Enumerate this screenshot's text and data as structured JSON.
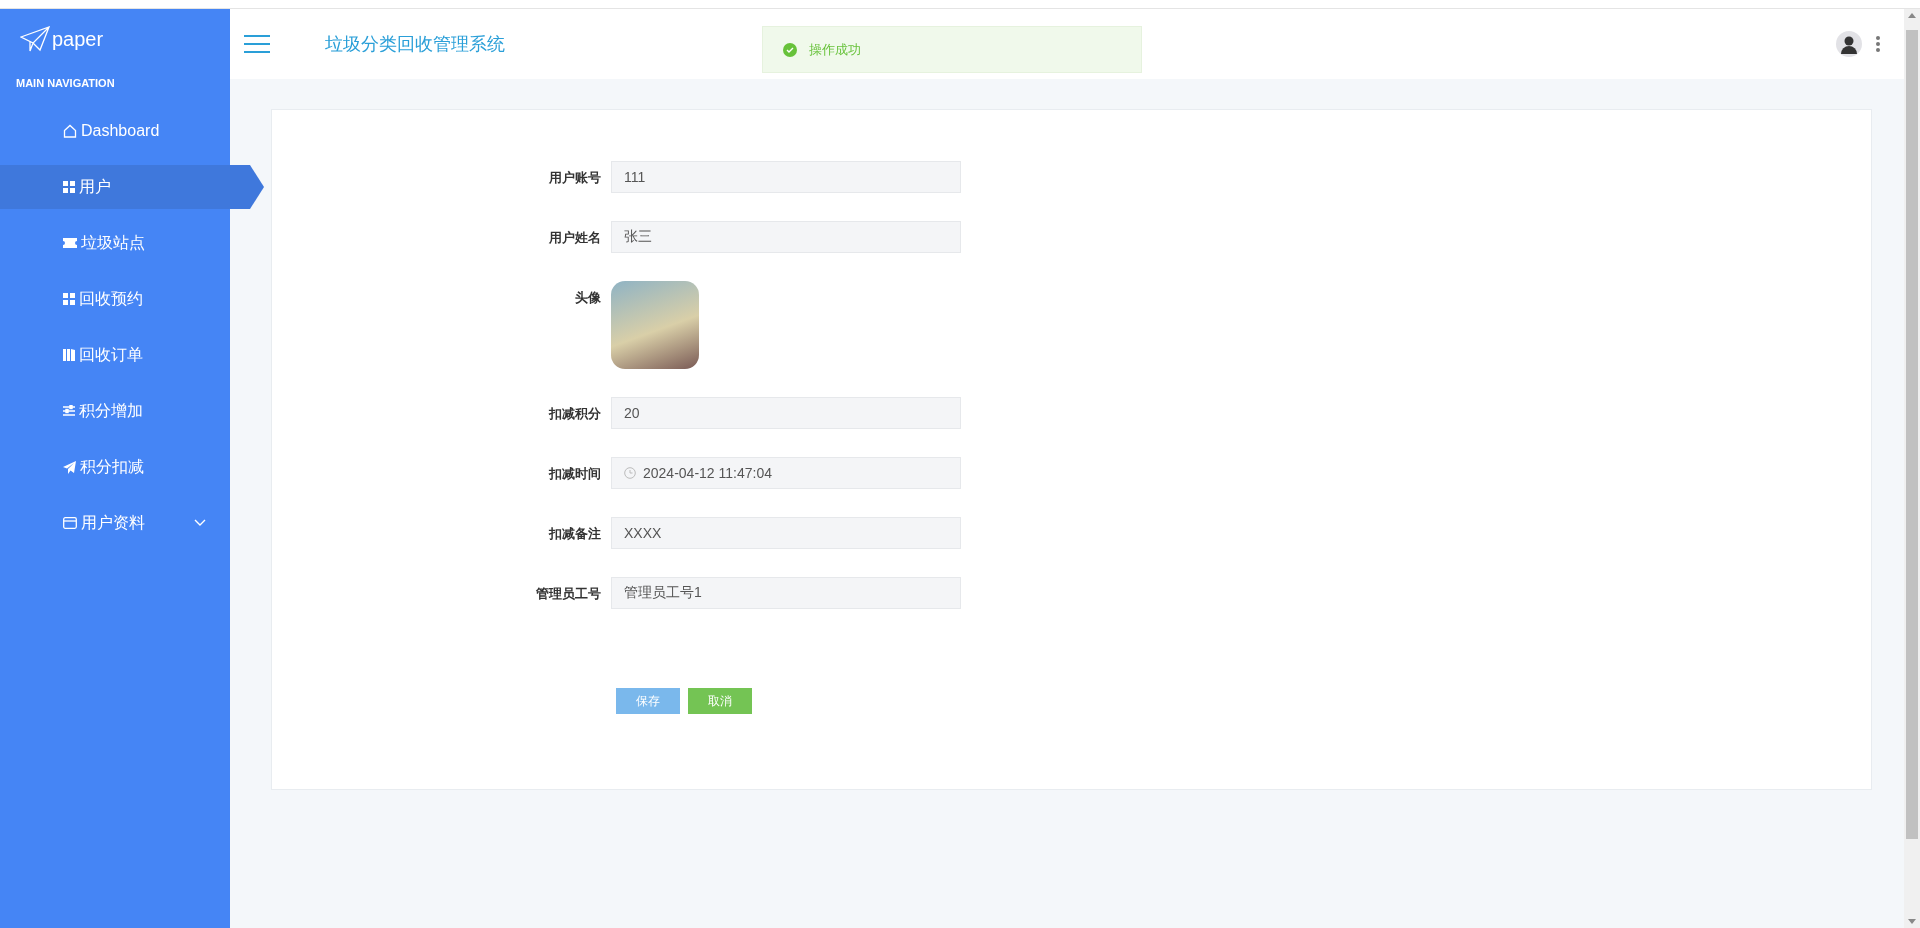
{
  "sidebar": {
    "logo": "paper",
    "section": "MAIN NAVIGATION",
    "items": [
      {
        "label": "Dashboard",
        "selected": false,
        "expandable": false
      },
      {
        "label": "用户",
        "selected": true,
        "expandable": false
      },
      {
        "label": "垃圾站点",
        "selected": false,
        "expandable": false
      },
      {
        "label": "回收预约",
        "selected": false,
        "expandable": false
      },
      {
        "label": "回收订单",
        "selected": false,
        "expandable": false
      },
      {
        "label": "积分增加",
        "selected": false,
        "expandable": false
      },
      {
        "label": "积分扣减",
        "selected": false,
        "expandable": false
      },
      {
        "label": "用户资料",
        "selected": false,
        "expandable": true
      }
    ]
  },
  "header": {
    "title": "垃圾分类回收管理系统"
  },
  "toast": {
    "kind": "success",
    "text": "操作成功"
  },
  "form": {
    "fields": [
      {
        "kind": "input",
        "label": "用户账号",
        "value": "111"
      },
      {
        "kind": "input",
        "label": "用户姓名",
        "value": "张三"
      },
      {
        "kind": "image",
        "label": "头像"
      },
      {
        "kind": "input",
        "label": "扣减积分",
        "value": "20"
      },
      {
        "kind": "datetime",
        "label": "扣减时间",
        "value": "2024-04-12 11:47:04"
      },
      {
        "kind": "input",
        "label": "扣减备注",
        "value": "XXXX"
      },
      {
        "kind": "input",
        "label": "管理员工号",
        "value": "管理员工号1"
      }
    ],
    "buttons": [
      {
        "kind": "primary",
        "label": "保存"
      },
      {
        "kind": "success",
        "label": "取消"
      }
    ]
  }
}
